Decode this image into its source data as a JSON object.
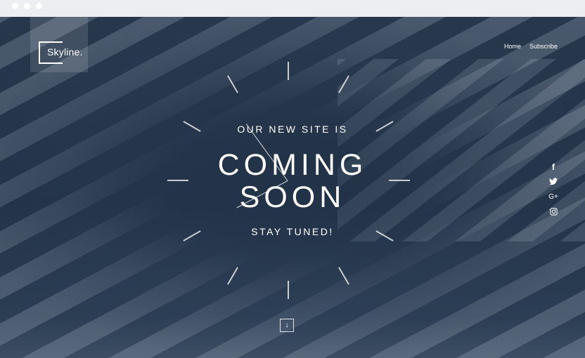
{
  "logo": {
    "text": "Skyline."
  },
  "nav": {
    "home": "Home",
    "subscribe": "Subscribe"
  },
  "hero": {
    "subtitle_top": "OUR NEW SITE IS",
    "title_line1": "COMING",
    "title_line2": "SOON",
    "subtitle_bottom": "STAY TUNED!"
  },
  "social": {
    "facebook": "f",
    "twitter": "🐦",
    "googleplus": "G+",
    "instagram": "◙"
  },
  "scroll": {
    "glyph": "↓"
  },
  "colors": {
    "overlay": "#2d3f55",
    "text": "#ffffff",
    "chrome": "#edeef1"
  }
}
